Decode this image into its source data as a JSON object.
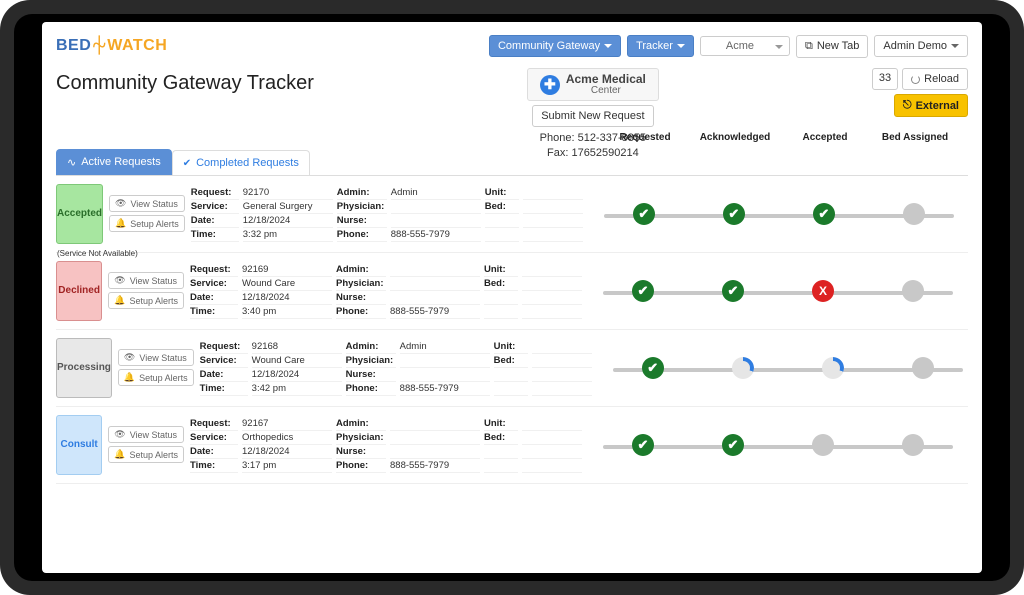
{
  "brand": {
    "left": "BED",
    "right": "WATCH"
  },
  "topnav": {
    "gateway": "Community Gateway",
    "tracker": "Tracker",
    "org_selected": "Acme",
    "newtab": "New Tab",
    "user": "Admin Demo"
  },
  "header": {
    "title": "Community Gateway Tracker",
    "hospital_name": "Acme Medical",
    "hospital_sub": "Center",
    "submit": "Submit New Request",
    "phone_label": "Phone:",
    "phone": "512-337-8855",
    "fax_label": "Fax:",
    "fax": "17652590214",
    "count": "33",
    "reload": "Reload",
    "external": "External"
  },
  "stages": [
    "Requested",
    "Acknowledged",
    "Accepted",
    "Bed Assigned"
  ],
  "tabs": {
    "active": "Active Requests",
    "completed": "Completed Requests"
  },
  "labels": {
    "request": "Request:",
    "service": "Service:",
    "date": "Date:",
    "time": "Time:",
    "admin": "Admin:",
    "physician": "Physician:",
    "nurse": "Nurse:",
    "phone": "Phone:",
    "unit": "Unit:",
    "bed": "Bed:",
    "view_status": "View Status",
    "setup_alerts": "Setup Alerts"
  },
  "rows": [
    {
      "status": "Accepted",
      "status_class": "b-green",
      "note": "",
      "request": "92170",
      "service": "General Surgery",
      "date": "12/18/2024",
      "time": "3:32 pm",
      "admin": "Admin",
      "physician": "",
      "nurse": "",
      "phone": "888-555-7979",
      "unit": "",
      "bed": "",
      "nodes": [
        "n-ok",
        "n-ok",
        "n-ok",
        "n-wait"
      ]
    },
    {
      "status": "Declined",
      "status_class": "b-red",
      "note": "(Service Not Available)",
      "request": "92169",
      "service": "Wound Care",
      "date": "12/18/2024",
      "time": "3:40 pm",
      "admin": "",
      "physician": "",
      "nurse": "",
      "phone": "888-555-7979",
      "unit": "",
      "bed": "",
      "nodes": [
        "n-ok",
        "n-ok",
        "n-x",
        "n-wait"
      ]
    },
    {
      "status": "Processing",
      "status_class": "b-gray",
      "note": "",
      "request": "92168",
      "service": "Wound Care",
      "date": "12/18/2024",
      "time": "3:42 pm",
      "admin": "Admin",
      "physician": "",
      "nurse": "",
      "phone": "888-555-7979",
      "unit": "",
      "bed": "",
      "nodes": [
        "n-ok",
        "n-spin",
        "n-spin",
        "n-wait"
      ]
    },
    {
      "status": "Consult",
      "status_class": "b-blue",
      "note": "",
      "request": "92167",
      "service": "Orthopedics",
      "date": "12/18/2024",
      "time": "3:17 pm",
      "admin": "",
      "physician": "",
      "nurse": "",
      "phone": "888-555-7979",
      "unit": "",
      "bed": "",
      "nodes": [
        "n-ok",
        "n-ok",
        "n-wait",
        "n-wait"
      ]
    }
  ]
}
